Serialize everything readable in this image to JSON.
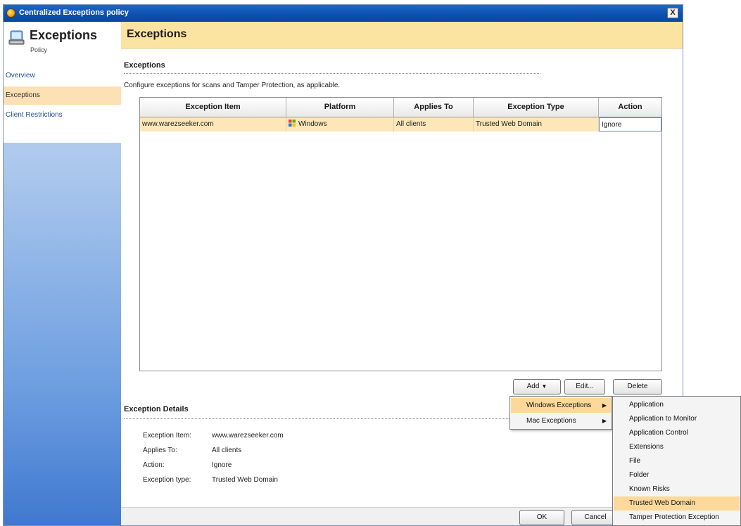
{
  "window": {
    "title": "Centralized Exceptions policy",
    "close_label": "X"
  },
  "nav": {
    "header_title": "Exceptions",
    "header_subtitle": "Policy",
    "items": [
      {
        "label": "Overview"
      },
      {
        "label": "Exceptions"
      },
      {
        "label": "Client Restrictions"
      }
    ]
  },
  "main": {
    "header_title": "Exceptions",
    "section_title": "Exceptions",
    "description": "Configure exceptions for scans and Tamper Protection, as applicable.",
    "table": {
      "columns": [
        "Exception Item",
        "Platform",
        "Applies To",
        "Exception Type",
        "Action"
      ],
      "rows": [
        {
          "item": "www.warezseeker.com",
          "platform": "Windows",
          "applies_to": "All clients",
          "type": "Trusted Web Domain",
          "action": "Ignore"
        }
      ]
    },
    "buttons": {
      "add": "Add",
      "edit": "Edit...",
      "delete": "Delete"
    },
    "details": {
      "title": "Exception Details",
      "item_label": "Exception Item:",
      "item_value": "www.warezseeker.com",
      "applies_label": "Applies To:",
      "applies_value": "All clients",
      "action_label": "Action:",
      "action_value": "Ignore",
      "type_label": "Exception type:",
      "type_value": "Trusted Web Domain"
    }
  },
  "footer": {
    "ok": "OK",
    "cancel": "Cancel"
  },
  "add_menu": {
    "items": [
      {
        "label": "Windows Exceptions"
      },
      {
        "label": "Mac Exceptions"
      }
    ]
  },
  "windows_submenu": {
    "items": [
      {
        "label": "Application"
      },
      {
        "label": "Application to Monitor"
      },
      {
        "label": "Application Control"
      },
      {
        "label": "Extensions"
      },
      {
        "label": "File"
      },
      {
        "label": "Folder"
      },
      {
        "label": "Known Risks"
      },
      {
        "label": "Trusted Web Domain"
      },
      {
        "label": "Tamper Protection Exception"
      }
    ]
  },
  "colors": {
    "title_bar": "#0b4fae",
    "header_band": "#fbe3a1",
    "selection": "#fde7b8",
    "menu_highlight": "#fcd99a"
  }
}
